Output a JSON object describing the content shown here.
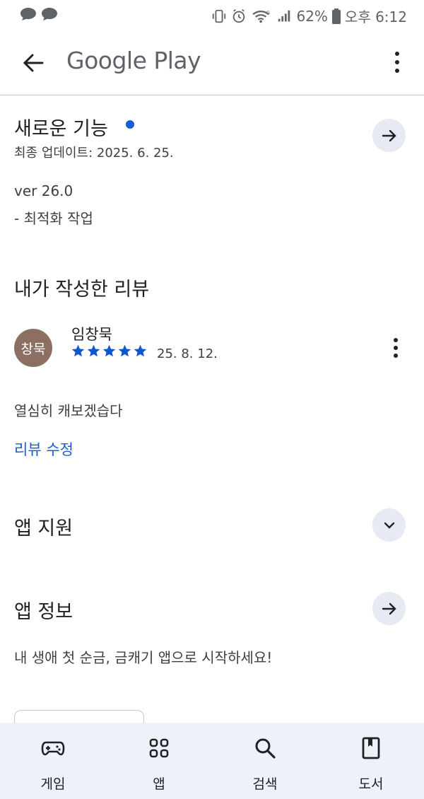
{
  "status_bar": {
    "battery_percent": "62%",
    "time": "오후 6:12",
    "icons": [
      "vibrate-icon",
      "alarm-icon",
      "wifi-icon",
      "signal-icon",
      "battery-icon"
    ]
  },
  "app_bar": {
    "title": "Google Play"
  },
  "whats_new": {
    "title": "새로운 기능",
    "updated": "최종 업데이트: 2025. 6. 25.",
    "version": "ver 26.0",
    "note": "- 최적화 작업",
    "dot_color": "#1a5bd8"
  },
  "my_review": {
    "title": "내가 작성한 리뷰",
    "avatar_text": "창묵",
    "avatar_color": "#8d6e63",
    "reviewer": "임창묵",
    "rating": 5,
    "date": "25. 8. 12.",
    "body": "열심히 캐보겠습다",
    "edit_link": "리뷰 수정"
  },
  "app_support": {
    "title": "앱 지원"
  },
  "app_info": {
    "title": "앱 정보",
    "description": "내 생애 첫 순금, 금캐기 앱으로 시작하세요!"
  },
  "bottom_nav": {
    "items": [
      {
        "label": "게임",
        "icon": "gamepad-icon"
      },
      {
        "label": "앱",
        "icon": "apps-grid-icon"
      },
      {
        "label": "검색",
        "icon": "search-icon"
      },
      {
        "label": "도서",
        "icon": "book-icon"
      }
    ]
  },
  "colors": {
    "accent": "#1a5bd8",
    "star": "#0b57d0",
    "button_bg": "#e8eaf3",
    "nav_bg": "#eef1f8"
  }
}
